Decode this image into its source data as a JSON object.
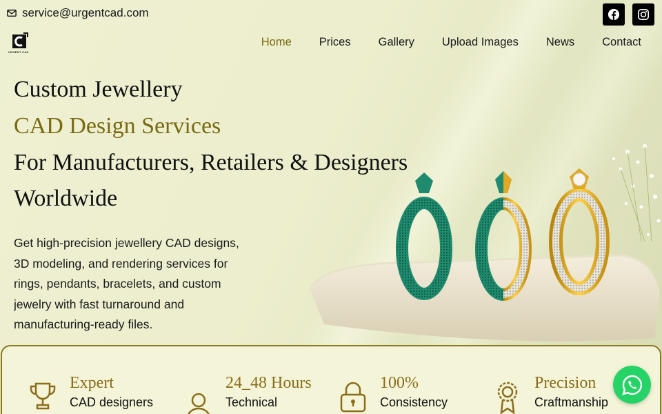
{
  "contact": {
    "email": "service@urgentcad.com"
  },
  "social": [
    {
      "name": "facebook"
    },
    {
      "name": "instagram"
    }
  ],
  "logo": {
    "text": "URGENT CAD"
  },
  "nav": {
    "items": [
      {
        "label": "Home",
        "active": true
      },
      {
        "label": "Prices"
      },
      {
        "label": "Gallery"
      },
      {
        "label": "Upload Images"
      },
      {
        "label": "News"
      },
      {
        "label": "Contact"
      }
    ]
  },
  "hero": {
    "line1": "Custom Jewellery",
    "line2": "CAD Design Services",
    "line3": "For Manufacturers, Retailers & Designers",
    "line4": "Worldwide",
    "description": "Get high-precision jewellery CAD designs, 3D modeling, and rendering services for rings, pendants, bracelets, and custom jewelry with fast turnaround and manufacturing-ready files."
  },
  "features": [
    {
      "title": "Expert",
      "subtitle": "CAD designers",
      "icon": "trophy-icon"
    },
    {
      "title": "24_48 Hours",
      "subtitle": "Technical",
      "icon": "person-icon"
    },
    {
      "title": "100%",
      "subtitle": "Consistency",
      "icon": "lock-icon"
    },
    {
      "title": "Precision",
      "subtitle": "Craftmanship",
      "icon": "award-icon"
    }
  ],
  "colors": {
    "accent": "#7a6a12",
    "gold": "#8a6d1a",
    "whatsapp": "#25d366",
    "ring_green": "#1f8a6e",
    "ring_gold": "#e2a823"
  }
}
